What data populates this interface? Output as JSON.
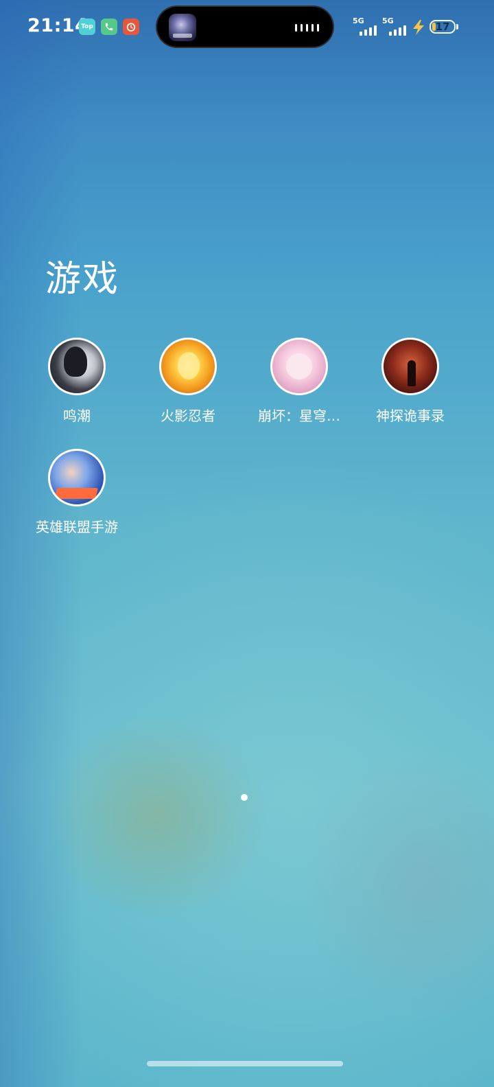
{
  "status_bar": {
    "time": "21:14",
    "notification_icons": [
      {
        "name": "top-app-icon",
        "label": "Top",
        "color": "#4fd0d6"
      },
      {
        "name": "phone-icon",
        "color": "#55c98a"
      },
      {
        "name": "clock-app-icon",
        "color": "#e8573c"
      }
    ],
    "dynamic_island": {
      "app_icon": "game-avatar-icon",
      "activity": "audio-waveform-icon"
    },
    "networks": [
      {
        "label": "5G",
        "signal": "full"
      },
      {
        "label": "5G",
        "signal": "full"
      }
    ],
    "charging_icon": "bolt-icon",
    "battery": {
      "level": "17",
      "fill_percent": 17,
      "fill_color": "#f3c34a"
    }
  },
  "folder": {
    "title": "游戏",
    "apps": [
      {
        "label": "鸣潮",
        "icon": "mingchao-app-icon"
      },
      {
        "label": "火影忍者",
        "icon": "naruto-app-icon"
      },
      {
        "label": "崩坏：星穹…",
        "icon": "honkai-star-rail-app-icon"
      },
      {
        "label": "神探诡事录",
        "icon": "detective-app-icon"
      },
      {
        "label": "英雄联盟手游",
        "icon": "lol-mobile-app-icon"
      }
    ]
  },
  "page_indicator": {
    "pages": 1,
    "current": 1
  },
  "home_indicator": "home-bar"
}
